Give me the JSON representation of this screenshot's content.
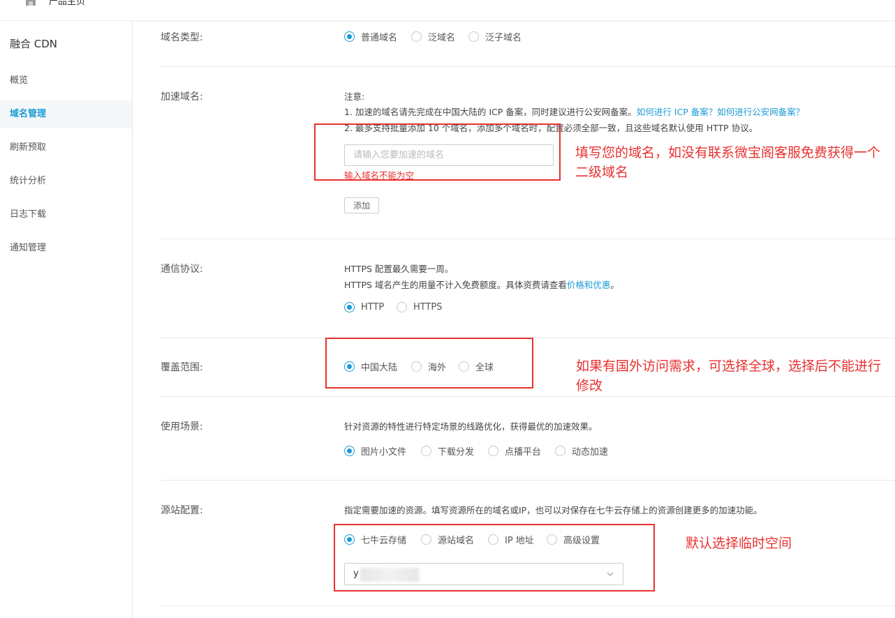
{
  "topbar": {
    "home_label": "产品主页",
    "home_icon": "home-icon"
  },
  "sidebar": {
    "product_title": "融合 CDN",
    "items": [
      {
        "label": "概览",
        "active": false
      },
      {
        "label": "域名管理",
        "active": true
      },
      {
        "label": "刷新预取",
        "active": false
      },
      {
        "label": "统计分析",
        "active": false
      },
      {
        "label": "日志下载",
        "active": false
      },
      {
        "label": "通知管理",
        "active": false
      }
    ]
  },
  "form": {
    "domain_type": {
      "label": "域名类型:",
      "options": [
        "普通域名",
        "泛域名",
        "泛子域名"
      ],
      "selected": "普通域名"
    },
    "accel_domain": {
      "label": "加速域名:",
      "note_title": "注意:",
      "note_1": "1. 加速的域名请先完成在中国大陆的 ICP 备案，同时建议进行公安网备案。",
      "note_1_link": "如何进行 ICP 备案？如何进行公安网备案？",
      "note_2": "2. 最多支持批量添加 10 个域名，添加多个域名时，配置必须全部一致，且这些域名默认使用 HTTP 协议。",
      "input_placeholder": "请输入您要加速的域名",
      "input_value": "",
      "error": "输入域名不能为空",
      "add_button": "添加"
    },
    "protocol": {
      "label": "通信协议:",
      "desc_1": "HTTPS 配置最久需要一周。",
      "desc_2": "HTTPS 域名产生的用量不计入免费额度。具体资费请查看",
      "desc_2_link": "价格和优惠",
      "desc_2_end": "。",
      "options": [
        "HTTP",
        "HTTPS"
      ],
      "selected": "HTTP"
    },
    "coverage": {
      "label": "覆盖范围:",
      "options": [
        "中国大陆",
        "海外",
        "全球"
      ],
      "selected": "中国大陆"
    },
    "scenario": {
      "label": "使用场景:",
      "desc": "针对资源的特性进行特定场景的线路优化，获得最优的加速效果。",
      "options": [
        "图片小文件",
        "下载分发",
        "点播平台",
        "动态加速"
      ],
      "selected": "图片小文件"
    },
    "origin": {
      "label": "源站配置:",
      "desc": "指定需要加速的资源。填写资源所在的域名或IP，也可以对保存在七牛云存储上的资源创建更多的加速功能。",
      "options": [
        "七牛云存储",
        "源站域名",
        "IP 地址",
        "高级设置"
      ],
      "selected": "七牛云存储",
      "bucket_value": "y"
    }
  },
  "annotations": {
    "domain_note": "填写您的域名，如没有联系微宝阁客服免费获得一个二级域名",
    "coverage_note": "如果有国外访问需求，可选择全球，选择后不能进行修改",
    "origin_note": "默认选择临时空间",
    "color": "#e8312f"
  },
  "colors": {
    "accent": "#1a9bd7",
    "error": "#e8312f"
  }
}
